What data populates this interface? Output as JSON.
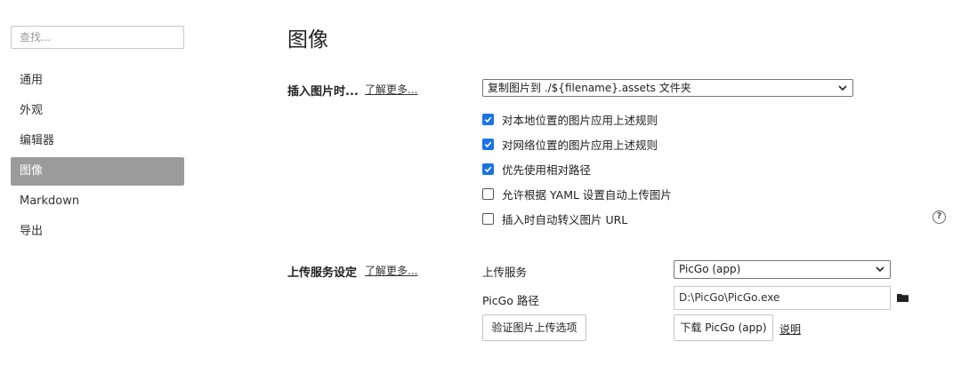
{
  "sidebar": {
    "search_placeholder": "查找...",
    "items": [
      {
        "label": "通用"
      },
      {
        "label": "外观"
      },
      {
        "label": "编辑器"
      },
      {
        "label": "图像",
        "active": true
      },
      {
        "label": "Markdown"
      },
      {
        "label": "导出"
      }
    ]
  },
  "main": {
    "title": "图像",
    "insert": {
      "label": "插入图片时...",
      "learn_more": "了解更多...",
      "select_value": "复制图片到 ./${filename}.assets 文件夹",
      "checkboxes": [
        {
          "label": "对本地位置的图片应用上述规则",
          "checked": true
        },
        {
          "label": "对网络位置的图片应用上述规则",
          "checked": true
        },
        {
          "label": "优先使用相对路径",
          "checked": true
        },
        {
          "label": "允许根据 YAML 设置自动上传图片",
          "checked": false
        },
        {
          "label": "插入时自动转义图片 URL",
          "checked": false
        }
      ],
      "help_icon": "?"
    },
    "upload": {
      "label": "上传服务设定",
      "learn_more": "了解更多...",
      "service_label": "上传服务",
      "service_value": "PicGo (app)",
      "path_label": "PicGo 路径",
      "path_value": "D:\\PicGo\\PicGo.exe",
      "verify_button": "验证图片上传选项",
      "download_button": "下载 PicGo (app)",
      "doc_link": "说明"
    }
  },
  "colors": {
    "active_nav": "#9b9b9b",
    "checkbox": "#1a73e8"
  }
}
